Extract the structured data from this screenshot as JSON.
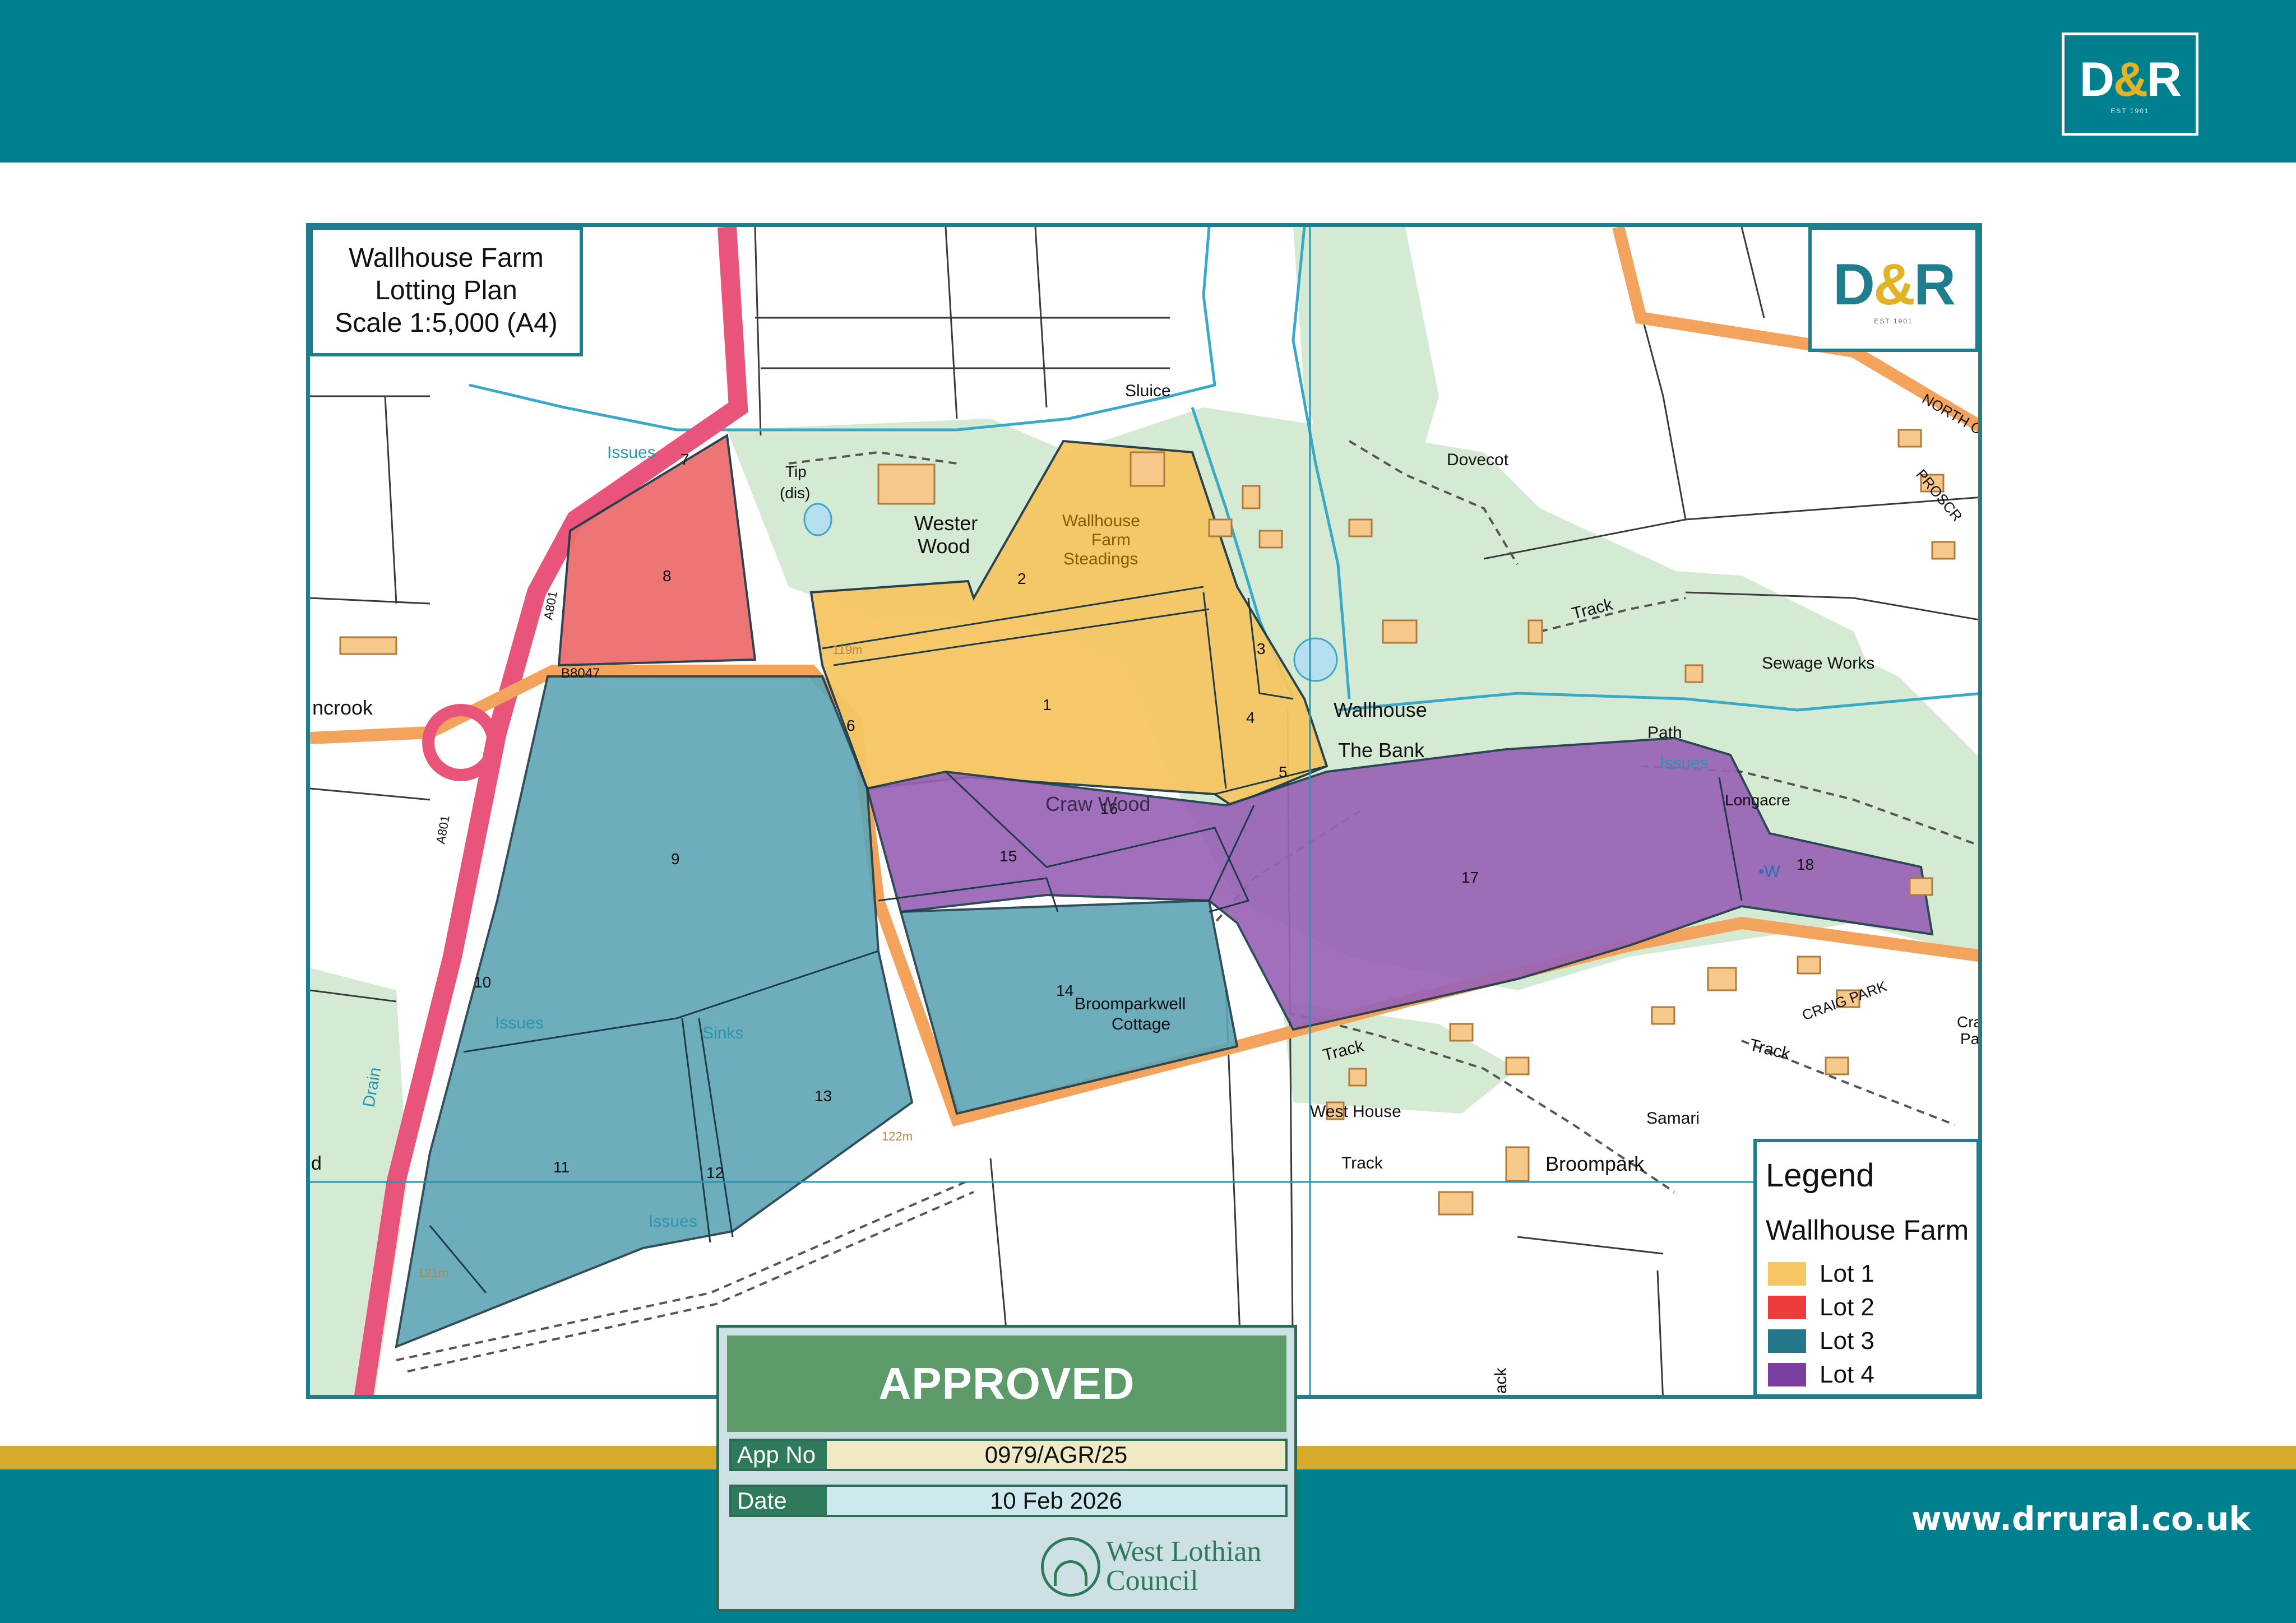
{
  "header": {
    "brand_mark": "D&R",
    "est": "EST 1901"
  },
  "footer": {
    "website": "www.drrural.co.uk"
  },
  "map": {
    "title_lines": [
      "Wallhouse Farm",
      "Lotting Plan",
      "Scale 1:5,000 (A4)"
    ],
    "brand_mark": "D&R",
    "est": "EST 1901",
    "lot_numbers": [
      "1",
      "2",
      "3",
      "4",
      "5",
      "6",
      "7",
      "8",
      "9",
      "10",
      "11",
      "12",
      "13",
      "14",
      "15",
      "16",
      "17",
      "18"
    ],
    "place_labels": {
      "sluice": "Sluice",
      "dovecot": "Dovecot",
      "tip": "Tip",
      "tip_dis": "(dis)",
      "wester": "Wester",
      "wood": "Wood",
      "wallhouse_farm": "Wallhouse",
      "farm": "Farm",
      "steadings": "Steadings",
      "wallhouse": "Wallhouse",
      "the_bank": "The Bank",
      "craw_wood": "Craw Wood",
      "broomparkwell": "Broomparkwell",
      "cottage": "Cottage",
      "sewage_works": "Sewage Works",
      "longacre": "Longacre",
      "path": "Path",
      "west_house": "West House",
      "samari": "Samari",
      "broompark": "Broompark",
      "track1": "Track",
      "track2": "Track",
      "track3": "Track",
      "track4": "Track",
      "track5": "ack",
      "craig_park": "CRAIG PARK",
      "north": "NORTH C",
      "prosc": "PROSCR",
      "cra": "Cra",
      "pa": "Pa",
      "ncrook": "ncrook",
      "d": "d",
      "drain": "Drain",
      "sinks": "Sinks",
      "w": "•W",
      "issues1": "Issues",
      "issues2": "Issues",
      "issues3": "Issues",
      "issues4": "Issues",
      "a801a": "A801",
      "a801b": "A801",
      "b8047": "B8047",
      "h119": "119m",
      "h122": "122m",
      "h121": "121m"
    },
    "legend": {
      "title": "Legend",
      "subtitle": "Wallhouse Farm",
      "items": [
        {
          "label": "Lot 1",
          "color": "#f6c663"
        },
        {
          "label": "Lot 2",
          "color": "#ee3b3b"
        },
        {
          "label": "Lot 3",
          "color": "#23788a"
        },
        {
          "label": "Lot 4",
          "color": "#7a3fa0"
        }
      ]
    }
  },
  "stamp": {
    "status": "APPROVED",
    "app_no_label": "App No",
    "app_no": "0979/AGR/25",
    "date_label": "Date",
    "date": "10 Feb 2026",
    "council_line1": "West Lothian",
    "council_line2": "Council"
  }
}
